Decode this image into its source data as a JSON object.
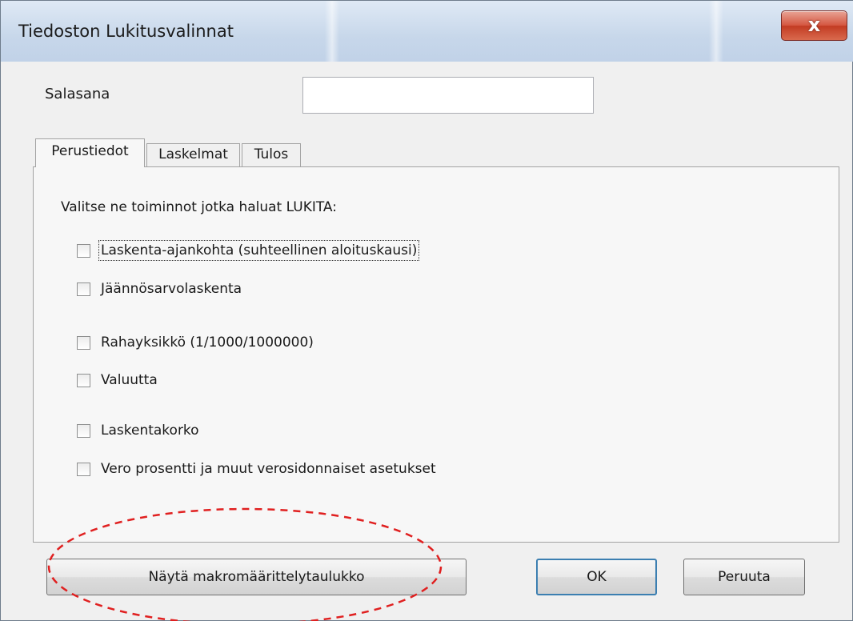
{
  "window": {
    "title": "Tiedoston Lukitusvalinnat",
    "close_glyph": "x"
  },
  "password": {
    "label": "Salasana",
    "value": ""
  },
  "tabs": [
    {
      "label": "Perustiedot",
      "active": true
    },
    {
      "label": "Laskelmat",
      "active": false
    },
    {
      "label": "Tulos",
      "active": false
    }
  ],
  "panel": {
    "instruction": "Valitse ne toiminnot jotka haluat LUKITA:",
    "options": [
      {
        "label": "Laskenta-ajankohta (suhteellinen aloituskausi)",
        "checked": false
      },
      {
        "label": "Jäännösarvolaskenta",
        "checked": false
      },
      {
        "label": "Rahayksikkö (1/1000/1000000)",
        "checked": false
      },
      {
        "label": "Valuutta",
        "checked": false
      },
      {
        "label": "Laskentakorko",
        "checked": false
      },
      {
        "label": "Vero prosentti ja muut verosidonnaiset asetukset",
        "checked": false
      }
    ]
  },
  "buttons": {
    "macro_label": "Näytä makromäärittelytaulukko",
    "ok_label": "OK",
    "cancel_label": "Peruuta"
  },
  "colors": {
    "annotation": "#e02020",
    "close_button": "#c8432b",
    "focus_border": "#3c7fb1"
  }
}
